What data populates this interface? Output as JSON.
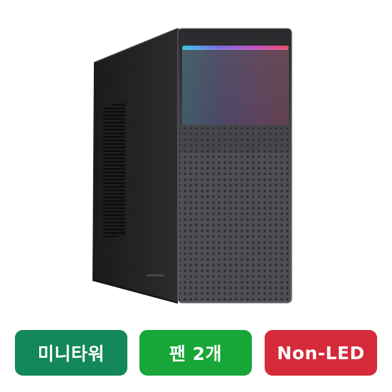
{
  "product": {
    "image_name": "mini-tower-pc-case",
    "brand_mark": "micronics"
  },
  "badges": [
    {
      "label": "미니타워",
      "color": "#12875a"
    },
    {
      "label": "팬 2개",
      "color": "#17a637"
    },
    {
      "label": "Non-LED",
      "color": "#d42a3a"
    }
  ]
}
